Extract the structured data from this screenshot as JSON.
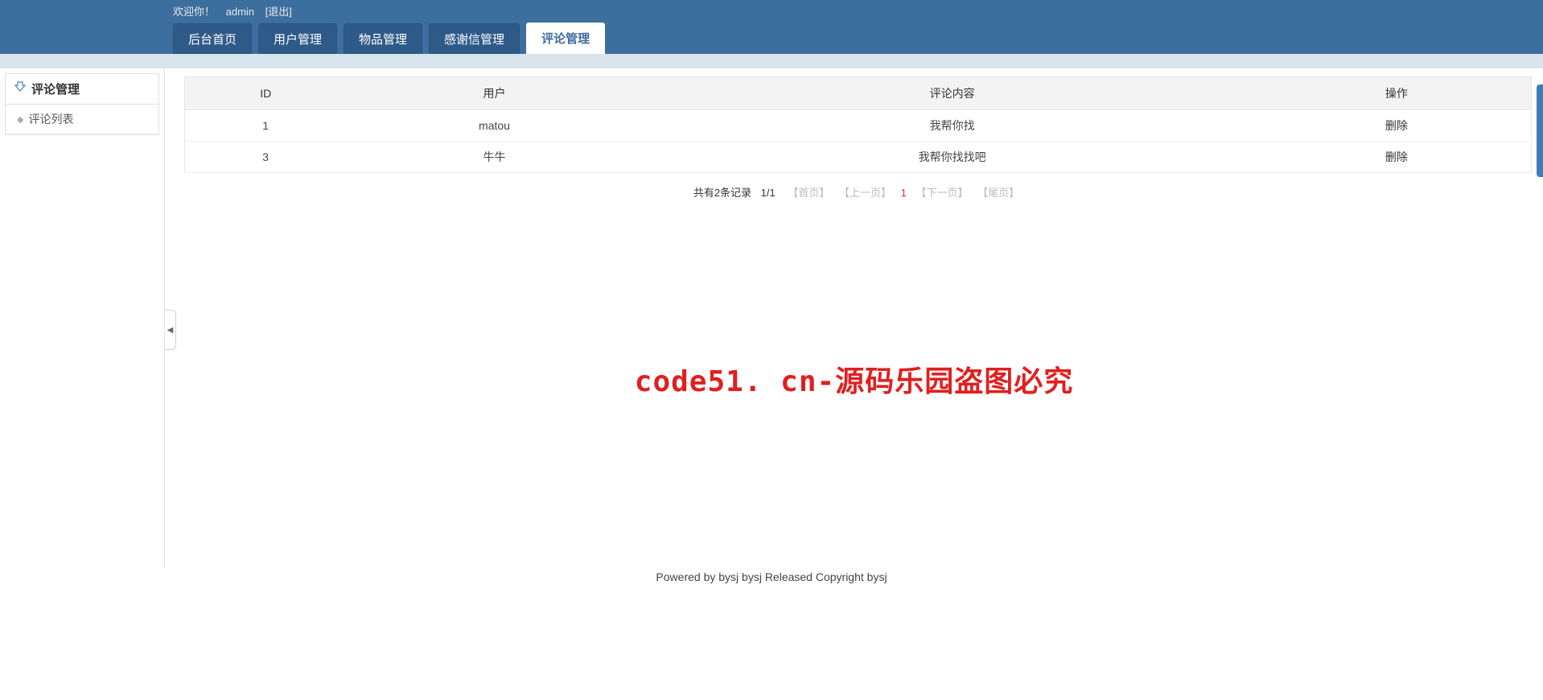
{
  "header": {
    "welcome_prefix": "欢迎你！",
    "username": "admin",
    "logout": "[退出]"
  },
  "nav": {
    "tabs": [
      {
        "label": "后台首页"
      },
      {
        "label": "用户管理"
      },
      {
        "label": "物品管理"
      },
      {
        "label": "感谢信管理"
      },
      {
        "label": "评论管理"
      }
    ],
    "active_index": 4
  },
  "sidebar": {
    "title": "评论管理",
    "items": [
      {
        "label": "评论列表"
      }
    ]
  },
  "table": {
    "columns": [
      "ID",
      "用户",
      "评论内容",
      "操作"
    ],
    "rows": [
      {
        "id": "1",
        "user": "matou",
        "content": "我帮你找",
        "action": "删除"
      },
      {
        "id": "3",
        "user": "牛牛",
        "content": "我帮你找找吧",
        "action": "删除"
      }
    ]
  },
  "pagination": {
    "summary": "共有2条记录",
    "page_of": "1/1",
    "first": "【首页】",
    "prev": "【上一页】",
    "current": "1",
    "next": "【下一页】",
    "last": "【尾页】"
  },
  "watermark": "code51. cn-源码乐园盗图必究",
  "footer": "Powered by bysj bysj Released  Copyright bysj"
}
